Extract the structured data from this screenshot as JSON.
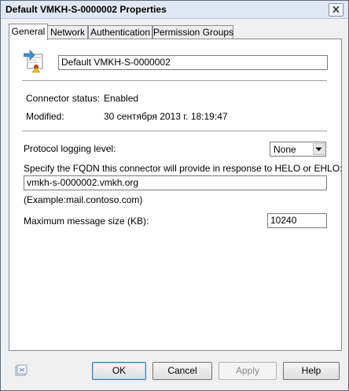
{
  "window": {
    "title": "Default VMKH-S-0000002 Properties"
  },
  "tabs": [
    {
      "label": "General"
    },
    {
      "label": "Network"
    },
    {
      "label": "Authentication"
    },
    {
      "label": "Permission Groups"
    }
  ],
  "general": {
    "connector_name": "Default VMKH-S-0000002",
    "status_label": "Connector status:",
    "status_value": "Enabled",
    "modified_label": "Modified:",
    "modified_value": "30 сентября 2013 г. 18:19:47",
    "logging_label": "Protocol logging level:",
    "logging_value": "None",
    "fqdn_label": "Specify the FQDN this connector will provide in response to HELO or EHLO:",
    "fqdn_value": "vmkh-s-0000002.vmkh.org",
    "fqdn_example": "(Example:mail.contoso.com)",
    "max_size_label": "Maximum message size (KB):",
    "max_size_value": "10240"
  },
  "buttons": {
    "ok": "OK",
    "cancel": "Cancel",
    "apply": "Apply",
    "help": "Help"
  },
  "icons": {
    "connector": "receive-connector-icon",
    "bottom": "help-context-icon",
    "close": "close-icon",
    "dropdown": "chevron-down-icon"
  }
}
